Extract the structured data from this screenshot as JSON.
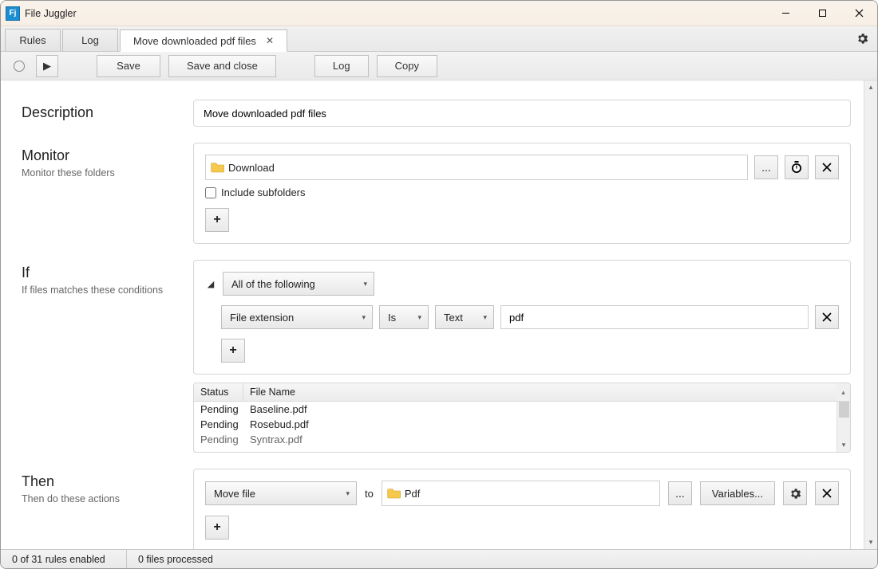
{
  "app": {
    "title": "File Juggler",
    "icon_text": "Fj"
  },
  "window_controls": {
    "minimize": "–",
    "maximize": "▢",
    "close": "✕"
  },
  "tabs": [
    {
      "label": "Rules",
      "active": false,
      "closable": false
    },
    {
      "label": "Log",
      "active": false,
      "closable": false
    },
    {
      "label": "Move downloaded pdf files",
      "active": true,
      "closable": true
    }
  ],
  "toolbar": {
    "play": "▶",
    "save_label": "Save",
    "save_close_label": "Save and close",
    "log_label": "Log",
    "copy_label": "Copy"
  },
  "description": {
    "heading": "Description",
    "value": "Move downloaded pdf files"
  },
  "monitor": {
    "heading": "Monitor",
    "sub": "Monitor these folders",
    "folder": "Download",
    "browse": "...",
    "include_subfolders_label": "Include subfolders",
    "include_subfolders_checked": false,
    "add": "+"
  },
  "if": {
    "heading": "If",
    "sub": "If files matches these conditions",
    "group_mode": "All of the following",
    "condition": {
      "field": "File extension",
      "op": "Is",
      "type": "Text",
      "value": "pdf"
    },
    "add": "+",
    "matches": {
      "columns": {
        "status": "Status",
        "filename": "File Name"
      },
      "rows": [
        {
          "status": "Pending",
          "filename": "Baseline.pdf"
        },
        {
          "status": "Pending",
          "filename": "Rosebud.pdf"
        },
        {
          "status": "Pending",
          "filename": "Syntrax.pdf"
        }
      ]
    }
  },
  "then": {
    "heading": "Then",
    "sub": "Then do these actions",
    "action": "Move file",
    "to_label": "to",
    "dest_folder": "Pdf",
    "browse": "...",
    "variables_label": "Variables...",
    "add": "+"
  },
  "statusbar": {
    "rules": "0 of 31 rules enabled",
    "files": "0 files processed"
  }
}
